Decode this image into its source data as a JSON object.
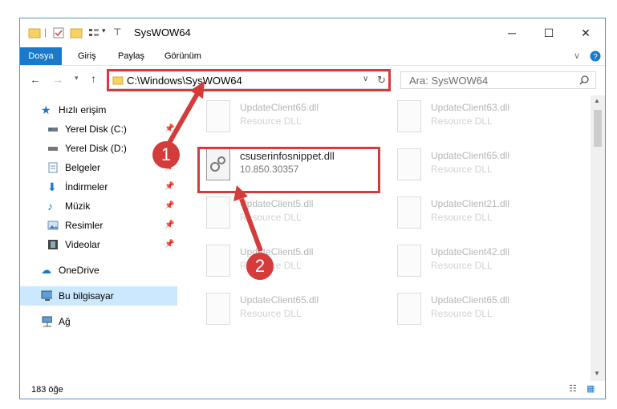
{
  "window": {
    "title": "SysWOW64"
  },
  "ribbon": {
    "tabs": [
      "Dosya",
      "Giriş",
      "Paylaş",
      "Görünüm"
    ]
  },
  "nav": {
    "address": "C:\\Windows\\SysWOW64",
    "search_placeholder": "Ara: SysWOW64"
  },
  "sidebar": {
    "items": [
      {
        "label": "Hızlı erişim",
        "icon": "star-icon"
      },
      {
        "label": "Yerel Disk (C:)",
        "icon": "drive-icon",
        "pinned": true
      },
      {
        "label": "Yerel Disk (D:)",
        "icon": "drive-icon",
        "pinned": true
      },
      {
        "label": "Belgeler",
        "icon": "documents-icon",
        "pinned": true
      },
      {
        "label": "İndirmeler",
        "icon": "download-icon",
        "pinned": true
      },
      {
        "label": "Müzik",
        "icon": "music-icon",
        "pinned": true
      },
      {
        "label": "Resimler",
        "icon": "pictures-icon",
        "pinned": true
      },
      {
        "label": "Videolar",
        "icon": "videos-icon",
        "pinned": true
      },
      {
        "label": "OneDrive",
        "icon": "cloud-icon"
      },
      {
        "label": "Bu bilgisayar",
        "icon": "computer-icon"
      },
      {
        "label": "Ağ",
        "icon": "network-icon"
      }
    ]
  },
  "files": [
    {
      "name": "UpdateClient65.dll",
      "desc": "Resource DLL"
    },
    {
      "name": "UpdateClient63.dll",
      "desc": "Resource DLL"
    },
    {
      "name": "csuserinfosnippet.dll",
      "desc": "10.850.30357"
    },
    {
      "name": "UpdateClient65.dll",
      "desc": "Resource DLL"
    },
    {
      "name": "UpdateClient5.dll",
      "desc": "Resource DLL"
    },
    {
      "name": "UpdateClient21.dll",
      "desc": "Resource DLL"
    },
    {
      "name": "UpdateClient5.dll",
      "desc": "Resource DLL"
    },
    {
      "name": "UpdateClient42.dll",
      "desc": "Resource DLL"
    },
    {
      "name": "UpdateClient65.dll",
      "desc": "Resource DLL"
    },
    {
      "name": "UpdateClient65.dll",
      "desc": "Resource DLL"
    }
  ],
  "status": {
    "count": "183 öğe"
  },
  "annotations": {
    "step1": "1",
    "step2": "2"
  },
  "colors": {
    "accent": "#1979ca",
    "highlight": "#d43b3b",
    "selected": "#cce8ff"
  }
}
